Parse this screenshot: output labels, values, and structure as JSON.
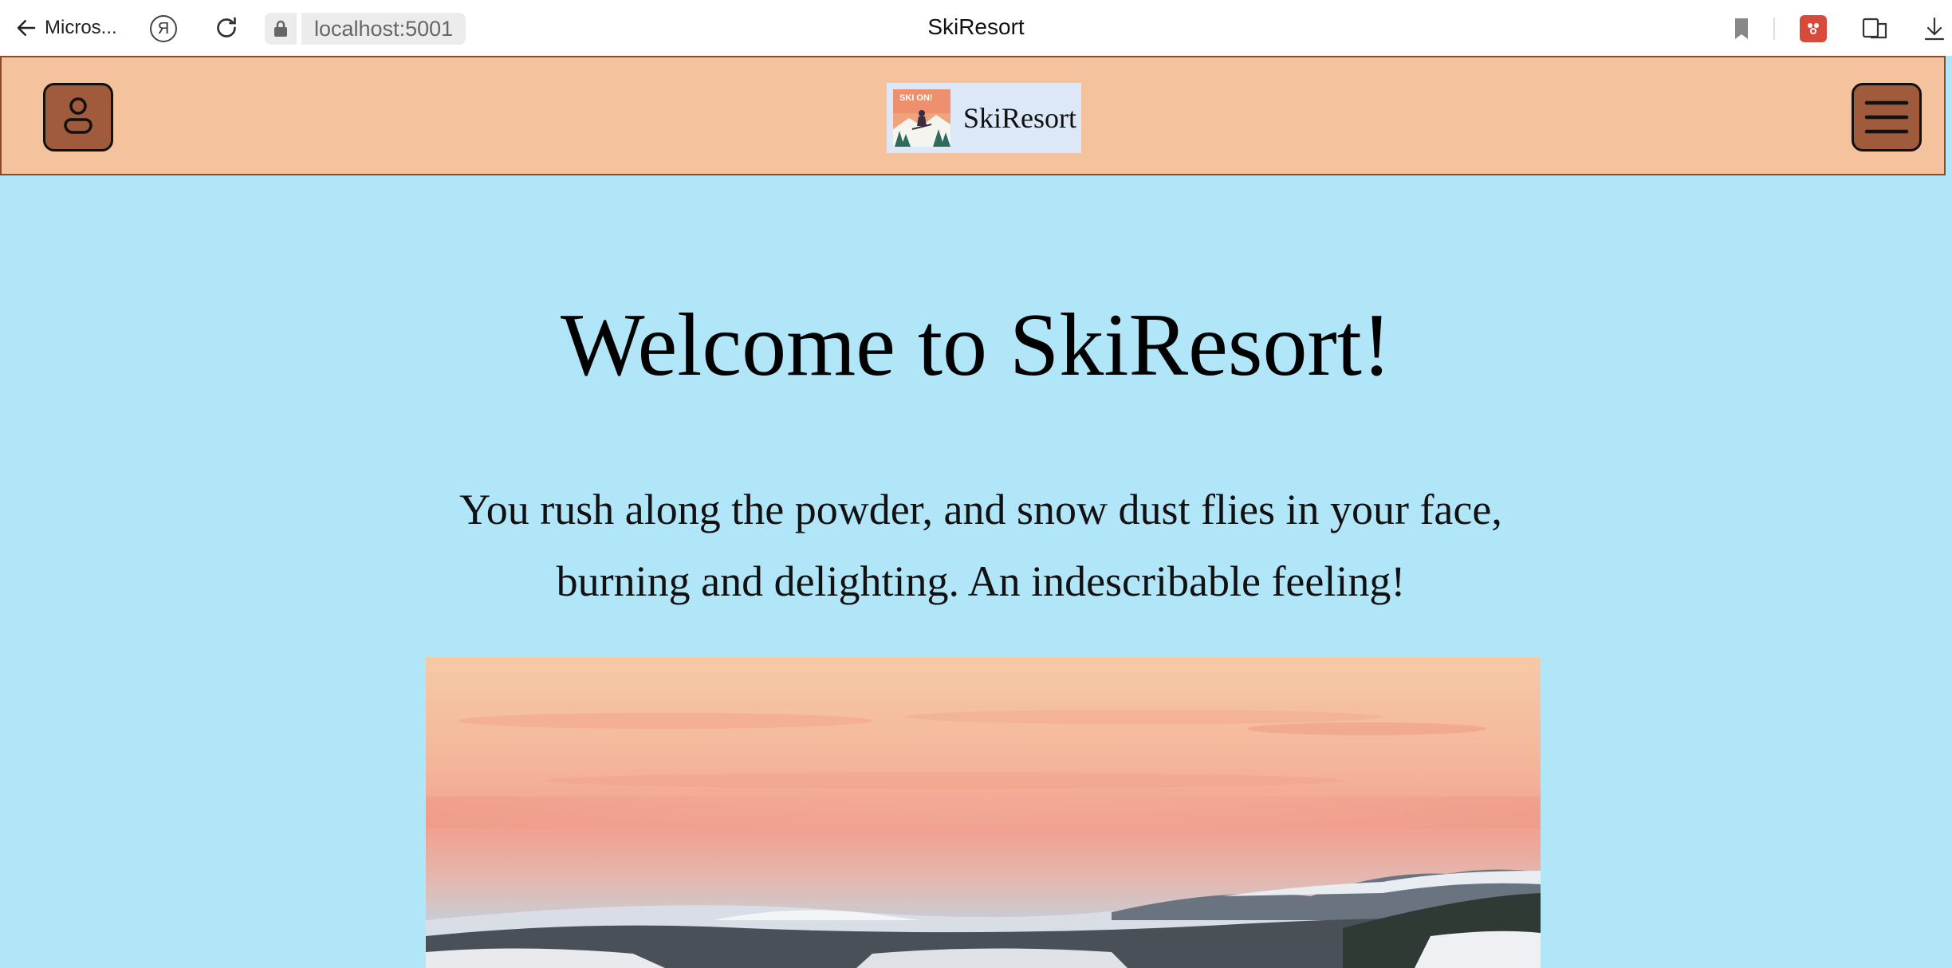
{
  "browser": {
    "back_label": "Micros...",
    "url": "localhost:5001",
    "tab_title": "SkiResort",
    "yandex_glyph": "Я",
    "icons": [
      "back-arrow-icon",
      "yandex-icon",
      "reload-icon",
      "lock-icon",
      "bookmark-icon",
      "extension-icon",
      "reader-icon",
      "download-icon"
    ]
  },
  "header": {
    "brand_name": "SkiResort",
    "logo_text": "SKI ON!",
    "background": "#f4c29d",
    "button_color": "#a05a3c"
  },
  "main": {
    "title": "Welcome to SkiResort!",
    "intro_line1": "You rush along the powder, and snow dust flies in your face,",
    "intro_line2": "burning and delighting. An indescribable feeling!",
    "background": "#b0e6f8"
  }
}
